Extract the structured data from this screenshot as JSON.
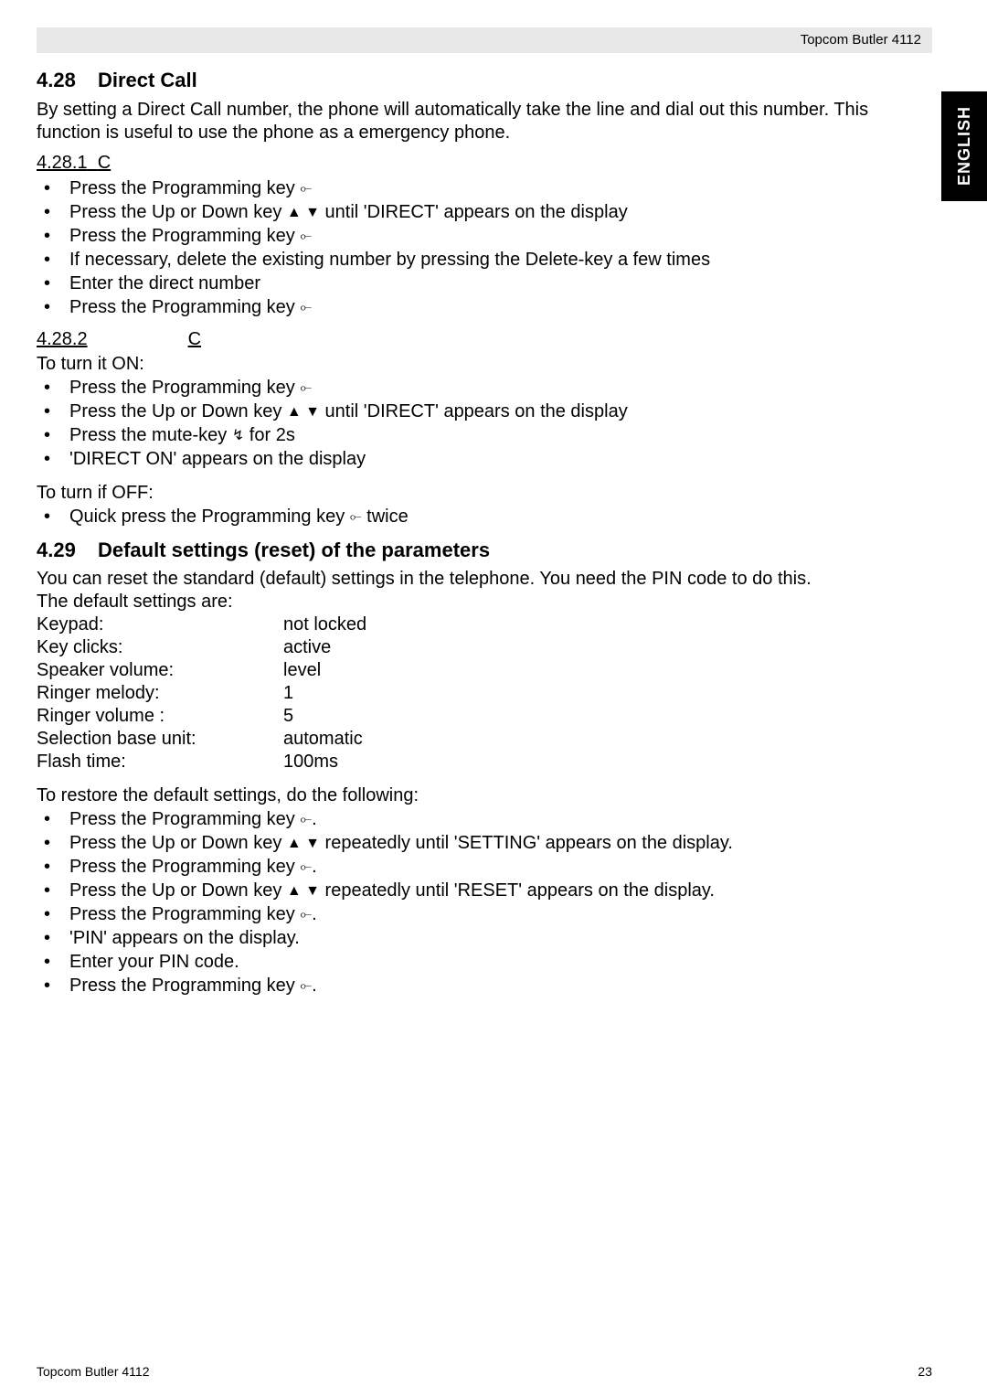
{
  "header": {
    "product": "Topcom Butler 4112"
  },
  "sidetab": {
    "label": "ENGLISH"
  },
  "sec428": {
    "num": "4.28",
    "title": "Direct Call",
    "intro": "By setting a Direct Call number, the phone will automatically take the line and dial out this number. This function is useful to use the phone as a emergency phone.",
    "sub1_num": "4.28.1",
    "sub1_letter": "C",
    "steps1": {
      "a_pre": "Press the Programming key ",
      "b_pre": "Press the Up or Down key ",
      "b_post": " until 'DIRECT' appears on the display",
      "c_pre": "Press the Programming key ",
      "d": "If necessary, delete the existing number by pressing the Delete-key a few times",
      "e": "Enter the direct number",
      "f_pre": "Press the Programming key "
    },
    "sub2_num": "4.28.2",
    "sub2_letter": "C",
    "on_intro": "To turn it ON:",
    "steps_on": {
      "a_pre": "Press the Programming key ",
      "b_pre": "Press the Up or Down key ",
      "b_post": " until 'DIRECT' appears on the display",
      "c_pre": "Press the mute-key ",
      "c_post": " for 2s",
      "d": "'DIRECT ON' appears on the display"
    },
    "off_intro": "To turn if OFF:",
    "steps_off": {
      "a_pre": "Quick press the Programming key ",
      "a_post": " twice"
    }
  },
  "sec429": {
    "num": "4.29",
    "title": "Default settings (reset) of the parameters",
    "intro": "You can reset the standard (default) settings in the telephone. You need the PIN code to do this.",
    "defaults_intro": "The default settings are:",
    "defaults": {
      "keypad_l": "Keypad:",
      "keypad_v": "not locked",
      "clicks_l": "Key clicks:",
      "clicks_v": "active",
      "speaker_l": "Speaker volume:",
      "speaker_v": "level",
      "rmelody_l": "Ringer melody:",
      "rmelody_v": "1",
      "rvol_l": "Ringer volume :",
      "rvol_v": "5",
      "base_l": "Selection base unit:",
      "base_v": "automatic",
      "flash_l": "Flash time:",
      "flash_v": "100ms"
    },
    "restore_intro": "To restore the default settings, do the following:",
    "steps": {
      "a_pre": "Press the Programming key ",
      "a_post": ".",
      "b_pre": "Press the Up or Down key ",
      "b_post": " repeatedly until 'SETTING' appears on the display.",
      "c_pre": "Press the Programming key ",
      "c_post": ".",
      "d_pre": "Press the Up or Down key ",
      "d_post": " repeatedly until 'RESET' appears on the display.",
      "e_pre": "Press the Programming key ",
      "e_post": ".",
      "f": "'PIN' appears on the display.",
      "g": "Enter your PIN code.",
      "h_pre": "Press the Programming key ",
      "h_post": "."
    }
  },
  "icons": {
    "prog": "⟜",
    "updown": "▲ ▼",
    "mute": "↯"
  },
  "footer": {
    "left": "Topcom Butler 4112",
    "right": "23"
  }
}
